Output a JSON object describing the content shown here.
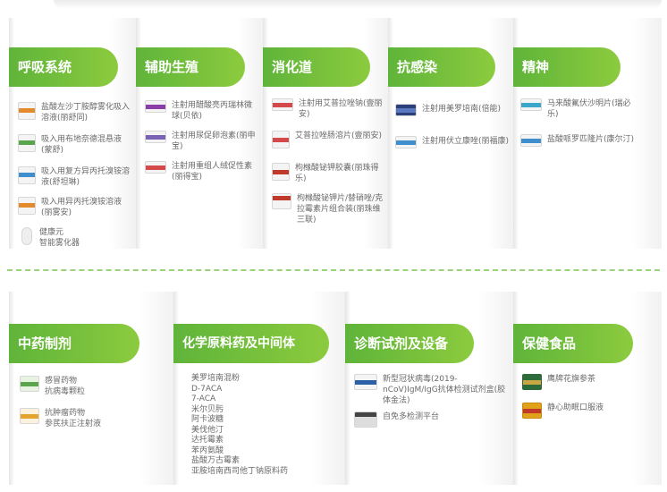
{
  "top_categories": [
    {
      "title": "呼吸系统",
      "items": [
        {
          "text": "盐酸左沙丁胺醇雾化吸入溶液(丽舒同)",
          "icon": "inhaler-box-icon",
          "color": "#e38b2c"
        },
        {
          "text": "吸入用布地奈德混悬液(蒙舒)",
          "icon": "inhaler-box-icon",
          "color": "#5aa54b"
        },
        {
          "text": "吸入用复方异丙托溴铵溶液(舒坦琳)",
          "icon": "inhaler-box-icon",
          "color": "#3f8fce"
        },
        {
          "text": "吸入用异丙托溴铵溶液(丽雾安)",
          "icon": "inhaler-box-icon",
          "color": "#e38b2c"
        },
        {
          "text": "健康元\n智能雾化器",
          "icon": "nebulizer-icon",
          "color": "#888888"
        }
      ]
    },
    {
      "title": "辅助生殖",
      "items": [
        {
          "text": "注射用醋酸亮丙瑞林微球(贝依)",
          "icon": "injection-box-icon",
          "color": "#8a3fa8"
        },
        {
          "text": "注射用尿促卵泡素(丽申宝)",
          "icon": "injection-box-icon",
          "color": "#7a62b5"
        },
        {
          "text": "注射用重组人绒促性素(丽得宝)",
          "icon": "injection-box-icon",
          "color": "#d44a4a"
        }
      ]
    },
    {
      "title": "消化道",
      "items": [
        {
          "text": "注射用艾普拉唑钠(壹丽安)",
          "icon": "injection-box-icon",
          "color": "#d44a4a"
        },
        {
          "text": "艾普拉唑肠溶片(壹丽安)",
          "icon": "tablet-box-icon",
          "color": "#d44a4a"
        },
        {
          "text": "枸橼酸铋钾胶囊(丽珠得乐)",
          "icon": "capsule-box-icon",
          "color": "#c0392b"
        },
        {
          "text": "枸橼酸铋钾片/替硝唑/克拉霉素片组合装(丽珠维三联)",
          "icon": "combo-box-icon",
          "color": "#c0392b"
        }
      ]
    },
    {
      "title": "抗感染",
      "items": [
        {
          "text": "注射用美罗培南(倍能)",
          "icon": "injection-box-icon",
          "color": "#2b3f7a"
        },
        {
          "text": "注射用伏立康唑(丽福康)",
          "icon": "injection-box-icon",
          "color": "#3f8fce"
        }
      ]
    },
    {
      "title": "精神",
      "items": [
        {
          "text": "马来酸氟伏沙明片(瑞必乐)",
          "icon": "tablet-box-icon",
          "color": "#3aa6c9"
        },
        {
          "text": "盐酸哌罗匹隆片(康尔汀)",
          "icon": "tablet-box-icon",
          "color": "#3f8fce"
        }
      ]
    }
  ],
  "bottom_categories": [
    {
      "title": "中药制剂",
      "items": [
        {
          "text": "感冒药物\n抗病毒颗粒",
          "icon": "granule-box-icon",
          "color": "#5aa54b"
        },
        {
          "text": "抗肿瘤药物\n参芪扶正注射液",
          "icon": "vials-icon",
          "color": "#e3a32c"
        }
      ]
    },
    {
      "title": "化学原料药及中间体",
      "list": [
        "美罗培南混粉",
        "D-7ACA",
        "7-ACA",
        "米尔贝肟",
        "阿卡波糖",
        "美伐他汀",
        "达托霉素",
        "苯丙氨酸",
        "盐酸万古霉素",
        "亚胺培南西司他丁钠原料药"
      ]
    },
    {
      "title": "诊断试剂及设备",
      "items": [
        {
          "text": "新型冠状病毒(2019-nCoV)IgM/IgG抗体检测试剂盒(胶体金法)",
          "icon": "test-kit-icon",
          "color": "#2b5fa8"
        },
        {
          "text": "自免多检测平台",
          "icon": "analyzer-icon",
          "color": "#444444"
        }
      ]
    },
    {
      "title": "保健食品",
      "items": [
        {
          "text": "鹰牌花旗参茶",
          "icon": "tea-box-icon",
          "color": "#2e6b3a"
        },
        {
          "text": "静心助眠口服液",
          "icon": "oral-liquid-box-icon",
          "color": "#e0a21a"
        }
      ]
    }
  ],
  "colors": {
    "header_start": "#5fb43a",
    "header_end": "#8ccb3e",
    "divider": "#9cd27a"
  }
}
